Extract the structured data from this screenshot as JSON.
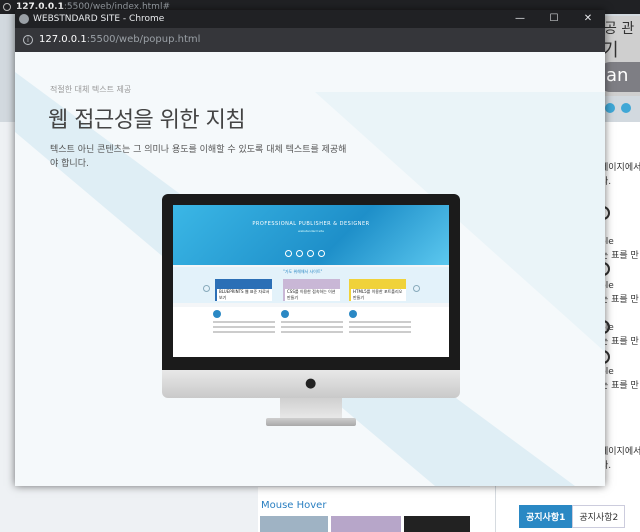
{
  "background": {
    "url": {
      "host": "127.0.0.1",
      "path": ":5500/web/index.html#"
    },
    "logo_glyphs": [
      "공 관",
      "기",
      "an"
    ],
    "right_rows": [
      {
        "text": "페이지에서"
      },
      {
        "text": "다."
      },
      {
        "text": "ble"
      },
      {
        "text": "는 표를 만"
      },
      {
        "text": "ble"
      },
      {
        "text": "는 표를 만"
      },
      {
        "text": "ble"
      },
      {
        "text": "는 표를 만"
      },
      {
        "text": "ble"
      },
      {
        "text": "는 표를 만"
      },
      {
        "text": "페이지에서"
      },
      {
        "text": "다."
      }
    ],
    "mouse_hover_title": "Mouse Hover",
    "notice_tabs": [
      "공지사항1",
      "공지사항2"
    ]
  },
  "popup": {
    "title": "WEBSTNDARD SITE - Chrome",
    "url": {
      "host": "127.0.0.1",
      "path": ":5500/web/popup.html"
    },
    "eyebrow": "적절한 대체 텍스트 제공",
    "headline": "웹 접근성을 위한 지침",
    "description": "텍스트 아닌 콘텐츠는 그 의미나 용도를 이해할 수 있도록 대체 텍스트를 제공해야 합니다.",
    "window_controls": [
      "—",
      "☐",
      "✕"
    ],
    "screen": {
      "hero_title": "PROFESSIONAL PUBLISHER & DESIGNER",
      "hero_sub": "webstandard site",
      "slider_label": "\"가도 위해해서 사이트\"",
      "cards": [
        "BLUEPRINTS 웹 표준 자료서 보기",
        "CSS를 이용한 접속하는 이션 만들기",
        "HTML5를 이용한 포트폴리오 만들기"
      ]
    }
  },
  "colors": {
    "accent": "#2a88c4",
    "chrome_dark": "#202124",
    "addr_dark": "#35363a"
  }
}
